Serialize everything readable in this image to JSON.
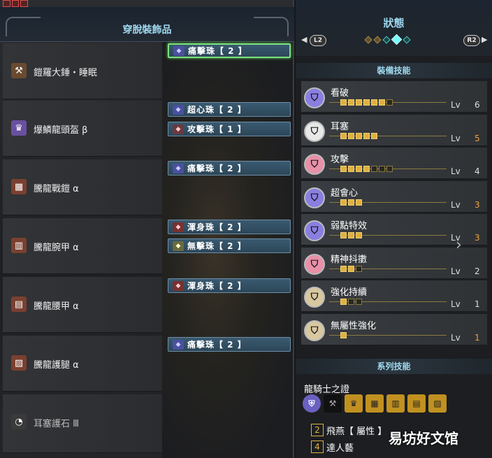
{
  "left_panel": {
    "title": "穿脫裝飾品",
    "equipment": [
      {
        "name": "鎧羅大錘・睡眠",
        "icon": "hammer-icon",
        "decorations": [
          {
            "name": "痛擊珠【 2 】",
            "selected": true
          }
        ]
      },
      {
        "name": "爆鱗龍頭盔 β",
        "icon": "helmet-icon",
        "decorations": [
          {
            "name": "超心珠【 2 】"
          },
          {
            "name": "攻擊珠【 1 】"
          }
        ]
      },
      {
        "name": "騰龍戰鎧 α",
        "icon": "chest-armor-icon",
        "decorations": [
          {
            "name": "痛擊珠【 2 】"
          }
        ]
      },
      {
        "name": "騰龍腕甲 α",
        "icon": "arm-armor-icon",
        "decorations": [
          {
            "name": "渾身珠【 2 】"
          },
          {
            "name": "無擊珠【 2 】"
          }
        ]
      },
      {
        "name": "騰龍腰甲 α",
        "icon": "waist-armor-icon",
        "decorations": [
          {
            "name": "渾身珠【 2 】"
          }
        ]
      },
      {
        "name": "騰龍護腿 α",
        "icon": "leg-armor-icon",
        "decorations": [
          {
            "name": "痛擊珠【 2 】"
          }
        ]
      },
      {
        "name": "耳塞護石 Ⅲ",
        "icon": "charm-icon",
        "decorations": []
      }
    ]
  },
  "right_panel": {
    "title": "狀態",
    "left_button": "L2",
    "right_button": "R2",
    "equipped_skills_title": "裝備技能",
    "skills": [
      {
        "name": "看破",
        "level": 6,
        "max": 7,
        "lv_label": "Lv",
        "color": "#8a7fe0",
        "maxed": false
      },
      {
        "name": "耳塞",
        "level": 5,
        "max": 5,
        "lv_label": "Lv",
        "color": "#e8e8e8",
        "maxed": true
      },
      {
        "name": "攻擊",
        "level": 4,
        "max": 7,
        "lv_label": "Lv",
        "color": "#e890a8",
        "maxed": false
      },
      {
        "name": "超會心",
        "level": 3,
        "max": 3,
        "lv_label": "Lv",
        "color": "#8a7fe0",
        "maxed": true
      },
      {
        "name": "弱點特效",
        "level": 3,
        "max": 3,
        "lv_label": "Lv",
        "color": "#8a7fe0",
        "maxed": true
      },
      {
        "name": "精神抖擻",
        "level": 2,
        "max": 3,
        "lv_label": "Lv",
        "color": "#e890a8",
        "maxed": false
      },
      {
        "name": "強化持續",
        "level": 1,
        "max": 3,
        "lv_label": "Lv",
        "color": "#d8c8a0",
        "maxed": false
      },
      {
        "name": "無屬性強化",
        "level": 1,
        "max": 1,
        "lv_label": "Lv",
        "color": "#d8c8a0",
        "maxed": true
      }
    ],
    "series_title": "系列技能",
    "series_name": "龍騎士之證",
    "series_bonuses": [
      {
        "count": "2",
        "name": "飛燕【 屬性 】"
      },
      {
        "count": "4",
        "name": "達人藝"
      }
    ]
  },
  "watermark": "易坊好文馆"
}
